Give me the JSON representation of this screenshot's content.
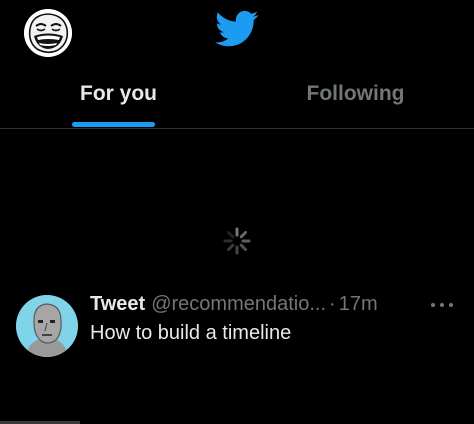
{
  "header": {
    "tabs": [
      {
        "label": "For you",
        "active": true
      },
      {
        "label": "Following",
        "active": false
      }
    ]
  },
  "feed": {
    "loading": true,
    "tweets": [
      {
        "name": "Tweet",
        "handle": "@recommendatio...",
        "separator": "·",
        "time": "17m",
        "text": "How to build a timeline"
      }
    ]
  },
  "colors": {
    "background": "#000000",
    "accent": "#1d9bf0",
    "text_primary": "#e7e9ea",
    "text_secondary": "#71767b",
    "divider": "#2f3336"
  },
  "icons": {
    "brand": "twitter-bird-icon",
    "loading": "spinner-icon",
    "more": "more-options-icon"
  }
}
